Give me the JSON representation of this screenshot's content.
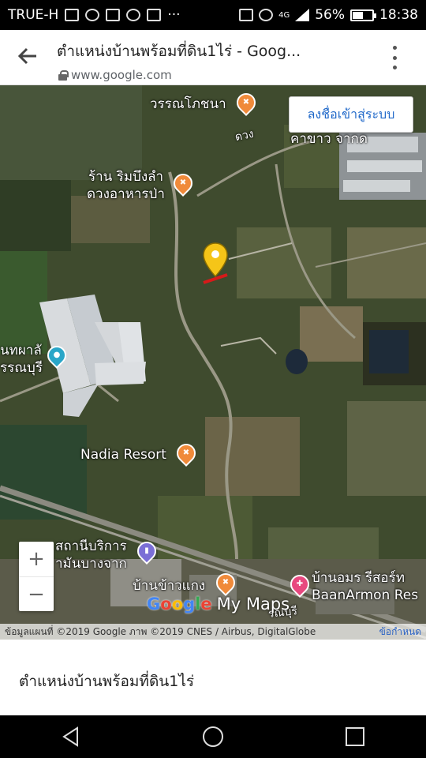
{
  "status_bar": {
    "carrier": "TRUE-H",
    "network": "4G",
    "battery_percent": "56%",
    "battery_level": 0.56,
    "time": "18:38",
    "more": "···"
  },
  "browser": {
    "title": "ตำแหน่งบ้านพร้อมที่ดิน1ไร่ - Goog...",
    "url": "www.google.com",
    "icons": [
      "back-arrow-icon",
      "lock-icon",
      "more-vertical-icon"
    ]
  },
  "map": {
    "signin_label": "ลงชื่อเข้าสู่ระบบ",
    "zoom_in": "+",
    "zoom_out": "−",
    "labels": {
      "vannon": "วรรณโภชนา",
      "road": "ดวง",
      "khao_chak": "คาขาว จากด",
      "rim_bueng": "ร้าน ริมบึงลำ",
      "duang_ahan": "ดวงอาหารป่า",
      "tuk_pha_1": "นทผาลั",
      "tuk_pha_2": "รรณบุรี",
      "nadia": "Nadia Resort",
      "station_1": "สถานีบริการ",
      "station_2": "ามันบางจาก",
      "khao_kaeng": "บ้านข้าวแกง",
      "armon_th": "บ้านอมร รีสอร์ท",
      "armon_en": "BaanArmon Res",
      "road_bottom": "รณบุรี"
    },
    "logo": {
      "google": [
        "G",
        "o",
        "o",
        "g",
        "l",
        "e"
      ],
      "my_maps": "My Maps"
    },
    "attribution": "ข้อมูลแผนที่ ©2019 Google ภาพ ©2019 CNES / Airbus, DigitalGlobe",
    "terms": "ข้อกำหนด",
    "colors": {
      "pin": "#f5c518",
      "poi_food": "#f08a3a",
      "poi_photo": "#2aa6c8",
      "poi_resort": "#e8487f",
      "link": "#1f68c9"
    }
  },
  "info_panel": {
    "title": "ตำแหน่งบ้านพร้อมที่ดิน1ไร่"
  },
  "nav_bar": {
    "icons": [
      "back-triangle-icon",
      "home-circle-icon",
      "recents-square-icon"
    ]
  }
}
